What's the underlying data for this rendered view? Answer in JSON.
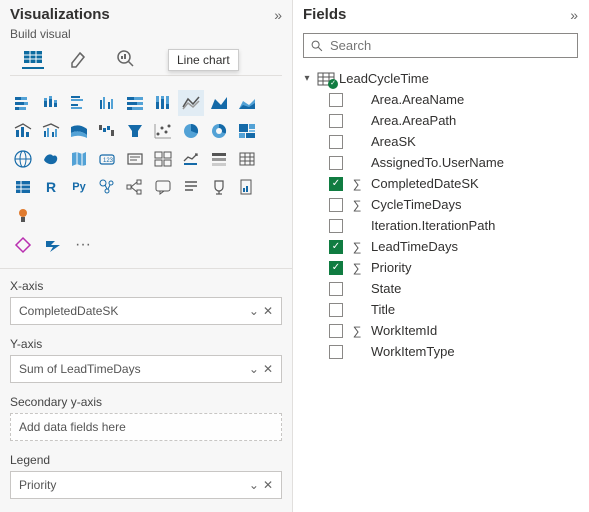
{
  "viz": {
    "title": "Visualizations",
    "build_label": "Build visual",
    "tooltip": "Line chart",
    "row5_r": "R",
    "row5_py": "Py",
    "ellipsis": "···",
    "zones": {
      "x": {
        "label": "X-axis",
        "value": "CompletedDateSK"
      },
      "y": {
        "label": "Y-axis",
        "value": "Sum of LeadTimeDays"
      },
      "y2": {
        "label": "Secondary y-axis",
        "value": "Add data fields here"
      },
      "legend": {
        "label": "Legend",
        "value": "Priority"
      }
    },
    "chevron": "⌄",
    "close": "✕"
  },
  "fields": {
    "title": "Fields",
    "search_placeholder": "Search",
    "table": {
      "name": "LeadCycleTime"
    },
    "items": [
      {
        "name": "Area.AreaName",
        "checked": false,
        "numeric": false
      },
      {
        "name": "Area.AreaPath",
        "checked": false,
        "numeric": false
      },
      {
        "name": "AreaSK",
        "checked": false,
        "numeric": false
      },
      {
        "name": "AssignedTo.UserName",
        "checked": false,
        "numeric": false
      },
      {
        "name": "CompletedDateSK",
        "checked": true,
        "numeric": true
      },
      {
        "name": "CycleTimeDays",
        "checked": false,
        "numeric": true
      },
      {
        "name": "Iteration.IterationPath",
        "checked": false,
        "numeric": false
      },
      {
        "name": "LeadTimeDays",
        "checked": true,
        "numeric": true
      },
      {
        "name": "Priority",
        "checked": true,
        "numeric": true
      },
      {
        "name": "State",
        "checked": false,
        "numeric": false
      },
      {
        "name": "Title",
        "checked": false,
        "numeric": false
      },
      {
        "name": "WorkItemId",
        "checked": false,
        "numeric": true
      },
      {
        "name": "WorkItemType",
        "checked": false,
        "numeric": false
      }
    ]
  },
  "collapse_glyph": "»"
}
